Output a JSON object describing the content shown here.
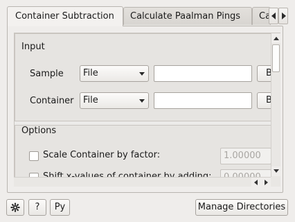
{
  "tabs": {
    "items": [
      {
        "label": "Container Subtraction",
        "active": true
      },
      {
        "label": "Calculate Paalman Pings",
        "active": false
      },
      {
        "label": "Ca",
        "active": false
      }
    ]
  },
  "input_group": {
    "title": "Input",
    "rows": [
      {
        "label": "Sample",
        "mode": "File",
        "value": "",
        "browse_label": "B"
      },
      {
        "label": "Container",
        "mode": "File",
        "value": "",
        "browse_label": "B"
      }
    ]
  },
  "options_group": {
    "title": "Options",
    "scale": {
      "label": "Scale Container by factor:",
      "checked": false,
      "value": "1.00000"
    },
    "shift": {
      "label": "Shift x-values of container by adding:",
      "checked": false,
      "value": "0.00000"
    }
  },
  "footer": {
    "settings_icon": "gear-icon",
    "help_label": "?",
    "python_label": "Py",
    "manage_dirs_label": "Manage Directories"
  }
}
